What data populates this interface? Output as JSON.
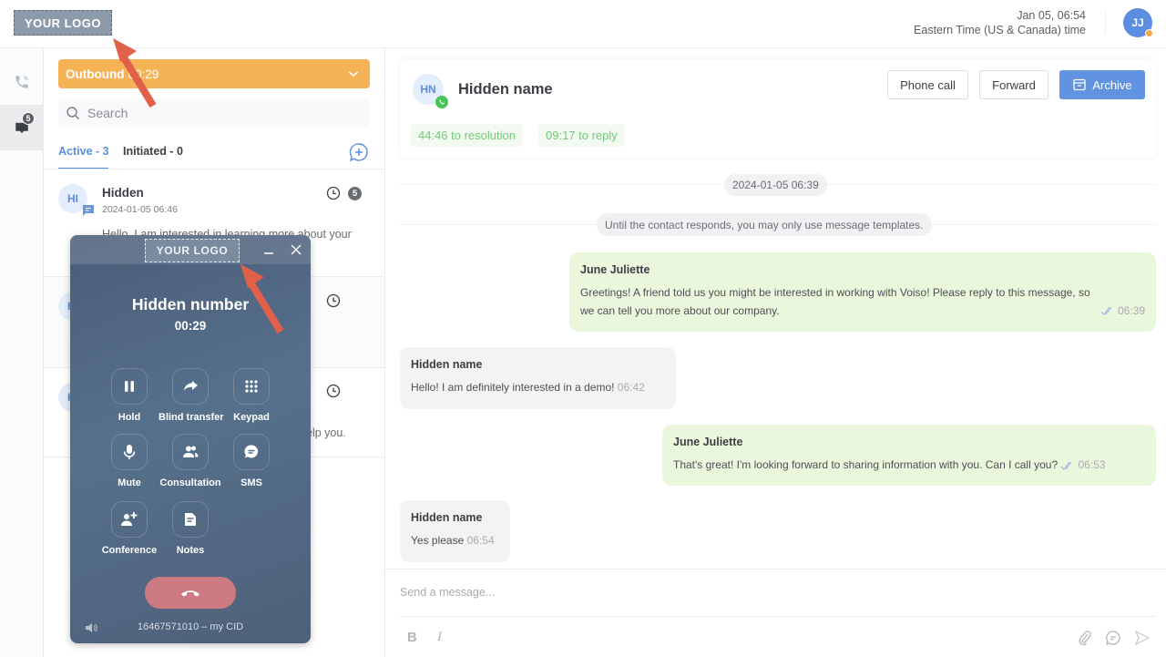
{
  "topbar": {
    "logo_text": "YOUR LOGO",
    "date_time": "Jan 05, 06:54",
    "timezone": "Eastern Time (US & Canada) time",
    "user_initials": "JJ",
    "user_status_color": "#f5a74a"
  },
  "rail": {
    "items": [
      {
        "icon": "phone-ringing-icon",
        "active": false
      },
      {
        "icon": "chat-inbox-icon",
        "active": true,
        "badge": "5"
      }
    ]
  },
  "list": {
    "outbound_label": "Outbound",
    "outbound_timer": "00:29",
    "search_placeholder": "Search",
    "tabs": [
      {
        "label": "Active - 3",
        "active": true
      },
      {
        "label": "Initiated - 0",
        "active": false
      }
    ],
    "conversations": [
      {
        "initials": "HI",
        "name": "Hidden",
        "time": "2024-01-05 06:46",
        "snippet": "Hello, I am interested in learning more about your",
        "unread": "5"
      },
      {
        "initials": "HI",
        "name": "",
        "time": "",
        "snippet": "",
        "unread": ""
      },
      {
        "initials": "HI",
        "name": "",
        "time": "",
        "snippet": "...elp you.",
        "unread": ""
      }
    ]
  },
  "chat": {
    "contact_initials": "HN",
    "contact_name": "Hidden name",
    "channel": "whatsapp",
    "sla_resolution": "44:46 to resolution",
    "sla_reply": "09:17 to reply",
    "buttons": {
      "phone_call": "Phone call",
      "forward": "Forward",
      "archive": "Archive"
    },
    "date_separator": "2024-01-05 06:39",
    "notice": "Until the contact responds, you may only use message templates.",
    "messages": [
      {
        "direction": "out",
        "author": "June Juliette",
        "text": "Greetings! A friend told us you might be interested in working with Voiso! Please reply to this message, so we can tell you more about our company.",
        "time": "06:39",
        "read": true
      },
      {
        "direction": "in",
        "author": "Hidden name",
        "text": "Hello! I am definitely interested in a demo!",
        "time": "06:42"
      },
      {
        "direction": "out",
        "author": "June Juliette",
        "text": "That's great! I'm looking forward to sharing information with you. Can I call you?",
        "time": "06:53",
        "read": true
      },
      {
        "direction": "in",
        "author": "Hidden name",
        "text": "Yes please",
        "time": "06:54"
      }
    ],
    "composer_placeholder": "Send a message...",
    "format_bold": "B",
    "format_italic": "I"
  },
  "softphone": {
    "logo_text": "YOUR LOGO",
    "caller": "Hidden number",
    "timer": "00:29",
    "buttons": [
      {
        "label": "Hold",
        "icon": "pause-icon"
      },
      {
        "label": "Blind transfer",
        "icon": "forward-arrow-icon"
      },
      {
        "label": "Keypad",
        "icon": "keypad-icon"
      },
      {
        "label": "Mute",
        "icon": "microphone-icon"
      },
      {
        "label": "Consultation",
        "icon": "people-icon"
      },
      {
        "label": "SMS",
        "icon": "sms-icon"
      },
      {
        "label": "Conference",
        "icon": "add-person-icon"
      },
      {
        "label": "Notes",
        "icon": "note-icon"
      }
    ],
    "caller_id": "16467571010 – my CID"
  },
  "colors": {
    "accent": "#5b8ee0",
    "outbound": "#f6b356",
    "outgoing_bubble": "#ebf7dd",
    "incoming_bubble": "#f3f3f4",
    "hangup": "#cd7a82",
    "annotation_arrow": "#e0604a"
  }
}
